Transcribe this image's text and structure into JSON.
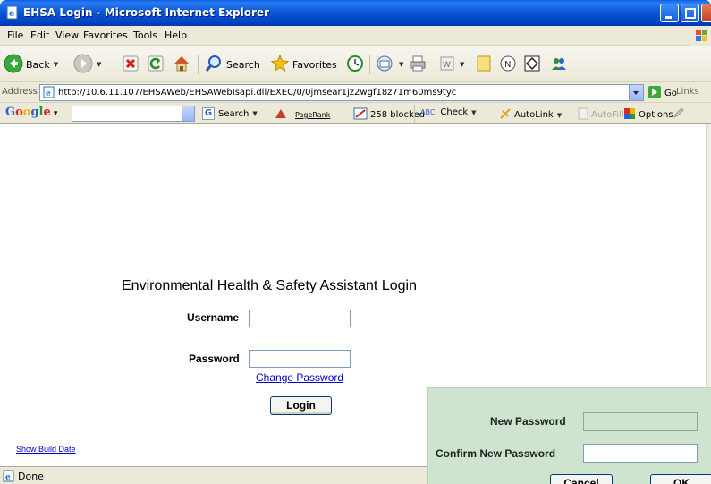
{
  "window": {
    "title": "EHSA Login - Microsoft Internet Explorer"
  },
  "menubar": {
    "items": [
      "File",
      "Edit",
      "View",
      "Favorites",
      "Tools",
      "Help"
    ]
  },
  "toolbar": {
    "back_label": "Back",
    "search_label": "Search",
    "favorites_label": "Favorites"
  },
  "addressbar": {
    "label": "Address",
    "url": "http://10.6.11.107/EHSAWeb/EHSAWebIsapi.dll/EXEC/0/0jmsear1jz2wgf18z71m60ms9tyc",
    "go_label": "Go",
    "links_label": "Links"
  },
  "googlebar": {
    "logo": "Google",
    "search_label": "Search",
    "pagerank_label": "PageRank",
    "blocked_label": "258 blocked",
    "check_label": "Check",
    "autolink_label": "AutoLink",
    "autofill_label": "AutoFill",
    "options_label": "Options"
  },
  "login": {
    "heading": "Environmental Health & Safety Assistant Login",
    "username_label": "Username",
    "username_value": "",
    "password_label": "Password",
    "password_value": "",
    "change_password_link": "Change Password",
    "login_button": "Login",
    "show_build_date_link": "Show Build Date"
  },
  "status": {
    "text": "Done"
  },
  "change_password_panel": {
    "new_password_label": "New Password",
    "confirm_label": "Confirm New Password",
    "cancel_button": "Cancel",
    "ok_button": "OK"
  }
}
